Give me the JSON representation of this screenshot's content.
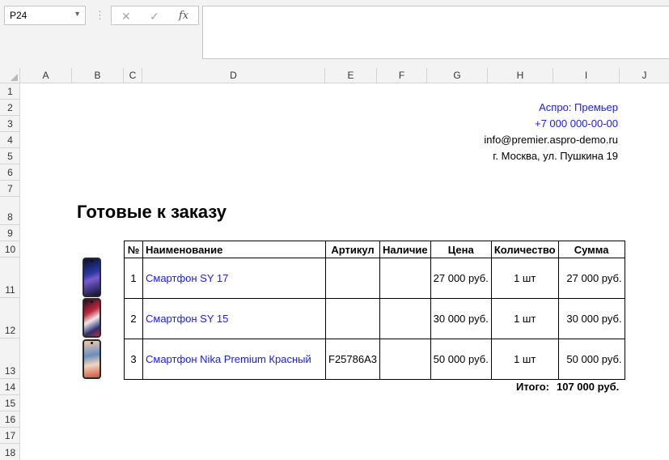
{
  "namebox": {
    "cell": "P24"
  },
  "formula_bar": {
    "cancel_glyph": "✕",
    "enter_glyph": "✓",
    "fx_label": "fx",
    "value": ""
  },
  "columns": [
    "A",
    "B",
    "C",
    "D",
    "E",
    "F",
    "G",
    "H",
    "I",
    "J"
  ],
  "rows": [
    "1",
    "2",
    "3",
    "4",
    "5",
    "6",
    "7",
    "8",
    "9",
    "10",
    "11",
    "12",
    "13",
    "14",
    "15",
    "16",
    "17",
    "18"
  ],
  "contacts": {
    "company": "Аспро: Премьер",
    "phone": "+7 000 000-00-00",
    "email": "info@premier.aspro-demo.ru",
    "address": "г. Москва, ул. Пушкина 19"
  },
  "title": "Готовые к заказу",
  "table": {
    "headers": [
      "№",
      "Наименование",
      "Артикул",
      "Наличие",
      "Цена",
      "Количество",
      "Сумма"
    ],
    "rows": [
      {
        "num": "1",
        "name": "Смартфон SY 17",
        "sku": "",
        "stock": "",
        "price": "27 000 руб.",
        "qty": "1 шт",
        "sum": "27 000 руб."
      },
      {
        "num": "2",
        "name": "Смартфон SY 15",
        "sku": "",
        "stock": "",
        "price": "30 000 руб.",
        "qty": "1 шт",
        "sum": "30 000 руб."
      },
      {
        "num": "3",
        "name": "Смартфон Nika Premium Красный",
        "sku": "F25786A3",
        "stock": "",
        "price": "50 000 руб.",
        "qty": "1 шт",
        "sum": "50 000 руб."
      }
    ]
  },
  "total": {
    "label": "Итого:",
    "value": "107 000 руб."
  },
  "colors": {
    "link": "#1a1aff",
    "header_bg": "#f3f3f3",
    "grid_line": "#d4d4d4"
  }
}
